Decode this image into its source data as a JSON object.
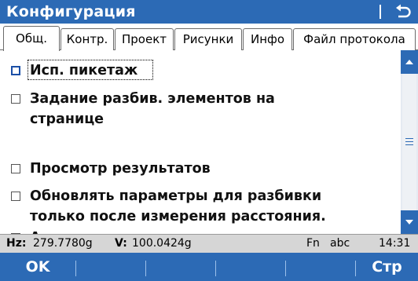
{
  "window": {
    "title": "Конфигурация",
    "back_icon": "back-arrow-icon"
  },
  "tabs": [
    {
      "label": "Общ.",
      "active": true
    },
    {
      "label": "Контр."
    },
    {
      "label": "Проект"
    },
    {
      "label": "Рисунки"
    },
    {
      "label": "Инфо"
    },
    {
      "label": "Файл протокола"
    }
  ],
  "options": [
    {
      "label": "Исп. пикетаж",
      "checked": false,
      "focused": true
    },
    {
      "label_line1": "Задание разбив. элементов на",
      "label_line2": "странице",
      "checked": false
    },
    {
      "label": "Просмотр результатов",
      "checked": false
    },
    {
      "label_line1": "Обновлять параметры для разбивки",
      "label_line2": "только после измерения расстояния.",
      "checked": false
    },
    {
      "label": "Автоматическое наведение на точку",
      "checked": false
    }
  ],
  "status": {
    "hz_label": "Hz:",
    "hz_value": "279.7780g",
    "v_label": "V:",
    "v_value": "100.0424g",
    "fn": "Fn",
    "input_mode": "abc",
    "time": "14:31"
  },
  "softkeys": {
    "ok": "OK",
    "page": "Стр"
  },
  "colors": {
    "accent": "#2c6ab5",
    "statusbar": "#d6d6d6"
  }
}
